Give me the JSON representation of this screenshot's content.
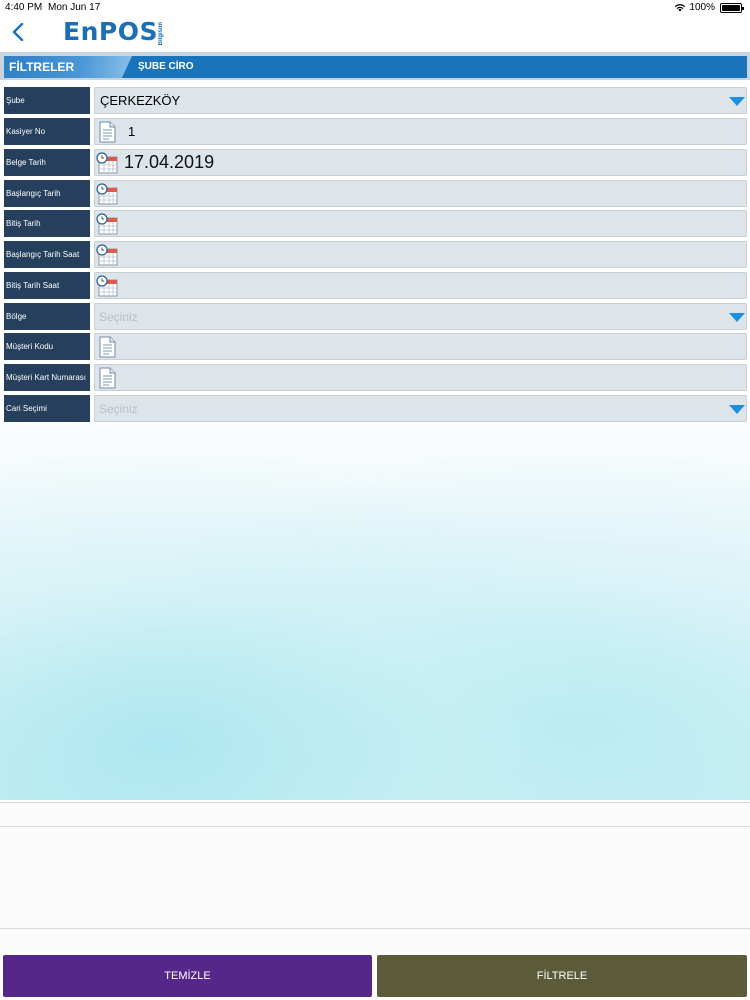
{
  "status_bar": {
    "time": "4:40 PM",
    "date": "Mon Jun 17",
    "battery": "100%"
  },
  "nav": {
    "logo": "EnPOS",
    "logo_sub": "Bilgisim"
  },
  "tabs": {
    "filters": "FİLTRELER",
    "title": "ŞUBE CİRO"
  },
  "form": {
    "sube": {
      "label": "Şube",
      "value": "ÇERKEZKÖY"
    },
    "kasiyer_no": {
      "label": "Kasiyer No",
      "value": "1"
    },
    "belge_tarih": {
      "label": "Belge Tarih",
      "value": "17.04.2019"
    },
    "baslangic_tarih": {
      "label": "Başlangıç Tarih",
      "value": ""
    },
    "bitis_tarih": {
      "label": "Bitiş Tarih",
      "value": ""
    },
    "baslangic_tarih_saat": {
      "label": "Başlangıç Tarih Saat",
      "value": ""
    },
    "bitis_tarih_saat": {
      "label": "Bitiş Tarih Saat",
      "value": ""
    },
    "bolge": {
      "label": "Bölge",
      "placeholder": "Seçiniz"
    },
    "musteri_kodu": {
      "label": "Müşteri Kodu",
      "value": ""
    },
    "musteri_kart_numarasi": {
      "label": "Müşteri Kart Numarası",
      "value": ""
    },
    "cari_secimi": {
      "label": "Cari Seçimi",
      "placeholder": "Seçiniz"
    }
  },
  "buttons": {
    "clear": "TEMİZLE",
    "filter": "FİLTRELE"
  },
  "colors": {
    "label_bg": "#253f5c",
    "tab_blue": "#1a74bc",
    "clear_button": "#55278b",
    "filter_button": "#5b5b3a",
    "dropdown_arrow": "#1c8fe0"
  }
}
